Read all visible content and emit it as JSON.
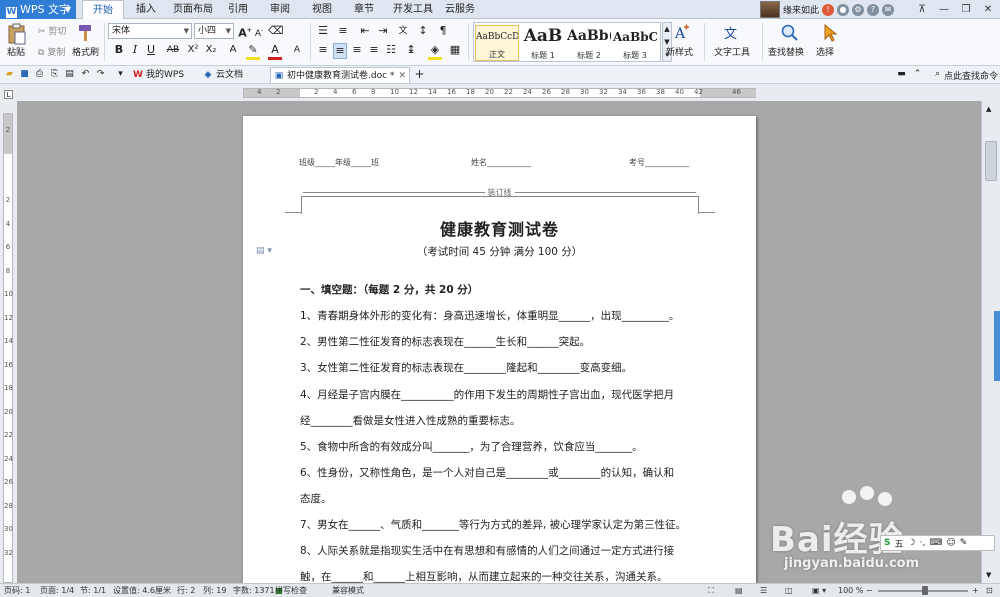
{
  "app": {
    "name": "WPS 文字",
    "menu_tabs": [
      {
        "label": "开始"
      },
      {
        "label": "插入"
      },
      {
        "label": "页面布局"
      },
      {
        "label": "引用"
      },
      {
        "label": "审阅"
      },
      {
        "label": "视图"
      },
      {
        "label": "章节"
      },
      {
        "label": "开发工具"
      },
      {
        "label": "云服务"
      }
    ],
    "user_name": "缘来如此"
  },
  "ribbon": {
    "paste": "粘贴",
    "cut": "剪切",
    "copy": "复制",
    "format_painter": "格式刷",
    "font_name": "宋体",
    "font_size": "小四",
    "styles": [
      {
        "preview": "AaBbCcD",
        "name": "正文"
      },
      {
        "preview": "AaB",
        "name": "标题 1"
      },
      {
        "preview": "AaBb(",
        "name": "标题 2"
      },
      {
        "preview": "AaBbC",
        "name": "标题 3"
      }
    ],
    "new_style": "新样式",
    "text_tools": "文字工具",
    "find_replace": "查找替换",
    "select": "选择"
  },
  "doc_tabs": [
    {
      "label": "我的WPS"
    },
    {
      "label": "云文档"
    },
    {
      "label": "初中健康教育测试卷.doc *"
    }
  ],
  "search_placeholder": "点此查找命令",
  "ruler_h": [
    "4",
    "2",
    "",
    "2",
    "4",
    "6",
    "8",
    "10",
    "12",
    "14",
    "16",
    "18",
    "20",
    "22",
    "24",
    "26",
    "28",
    "30",
    "32",
    "34",
    "36",
    "38",
    "40",
    "42",
    "",
    "46"
  ],
  "ruler_v": [
    "2",
    "",
    "",
    "2",
    "4",
    "6",
    "8",
    "10",
    "12",
    "14",
    "16",
    "18",
    "20",
    "22",
    "24",
    "26",
    "28",
    "30",
    "32"
  ],
  "document": {
    "header_class": "班级_____年级_____班",
    "header_name": "姓名___________",
    "header_id": "考号___________",
    "binding_label": "装订线",
    "title": "健康教育测试卷",
    "subtitle": "（考试时间 45 分钟    满分 100 分）",
    "section1": "一、填空题：（每题 2 分，共 20 分）",
    "lines": [
      "1、青春期身体外形的变化有：身高迅速增长，体重明显______，出现_________。",
      "2、男性第二性征发育的标志表现在______生长和______突起。",
      "3、女性第二性征发育的标志表现在________隆起和________变高变细。",
      "4、月经是子宫内膜在__________的作用下发生的周期性子宫出血，现代医学把月",
      "经________看做是女性进入性成熟的重要标志。",
      "5、食物中所含的有效成分叫_______，为了合理营养，饮食应当_______。",
      "6、性身份，又称性角色，是一个人对自己是________或________的认知，确认和",
      "态度。",
      "7、男女在______、气质和_______等行为方式的差异, 被心理学家认定为第三性征。",
      "8、人际关系就是指现实生活中在有思想和有感情的人们之间通过一定方式进行接",
      "触，在______和______上相互影响，从而建立起来的一种交往关系，沟通关系。"
    ]
  },
  "watermark": {
    "brand": "Bai经验",
    "url": "jingyan.baidu.com"
  },
  "ime": {
    "mode": "五"
  },
  "status": {
    "page_no": "页码: 1",
    "pages": "页面: 1/4",
    "section": "节: 1/1",
    "setting": "设置值: 4.6厘米",
    "row": "行: 2",
    "col": "列: 19",
    "words": "字数: 1371",
    "spell": "拼写检查",
    "compat": "兼容模式",
    "zoom": "100 %"
  }
}
